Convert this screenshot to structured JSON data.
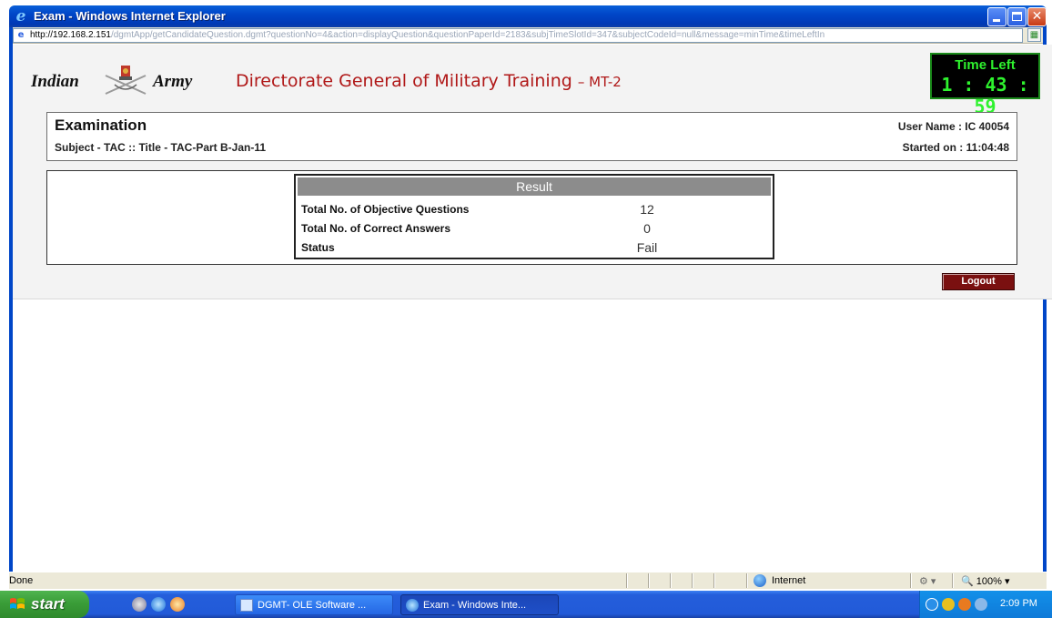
{
  "window": {
    "title": "Exam - Windows Internet Explorer",
    "url_host": "http://192.168.2.151",
    "url_path": "/dgmtApp/getCandidateQuestion.dgmt?questionNo=4&action=displayQuestion&questionPaperId=2183&subjTimeSlotId=347&subjectCodeId=null&message=minTime&timeLeftIn"
  },
  "header": {
    "logo_left": "Indian",
    "logo_right": "Army",
    "title": "Directorate General of Military Training",
    "title_suffix": "– MT-2"
  },
  "timer": {
    "label": "Time Left",
    "value": "1 : 43 : 59"
  },
  "exam": {
    "title": "Examination",
    "subject": "Subject - TAC :: Title - TAC-Part B-Jan-11",
    "user": "User Name : IC 40054",
    "started": "Started on : 11:04:48"
  },
  "result": {
    "heading": "Result",
    "rows": [
      {
        "label": "Total No. of Objective Questions",
        "value": "12"
      },
      {
        "label": "Total No. of Correct Answers",
        "value": "0"
      },
      {
        "label": "Status",
        "value": "Fail"
      }
    ]
  },
  "actions": {
    "logout_label": "Logout"
  },
  "statusbar": {
    "status": "Done",
    "zone": "Internet",
    "zoom": "100%"
  },
  "taskbar": {
    "start_label": "start",
    "tasks": [
      {
        "label": "DGMT- OLE Software ..."
      },
      {
        "label": "Exam - Windows Inte..."
      }
    ],
    "clock": "2:09 PM"
  },
  "colors": {
    "title_bar": "#0046c8",
    "header_title": "#b01818",
    "timer_text": "#2ef22e",
    "result_head": "#8c8c8c",
    "logout_bg": "#7a1010",
    "taskbar": "#245edb",
    "start_button": "#3a9d38"
  },
  "icons": {
    "title": "internet-explorer-icon",
    "page": "page-icon",
    "compat": "compatibility-view-icon",
    "emblem": "indian-army-emblem",
    "zone": "globe-icon",
    "start": "windows-flag-icon"
  }
}
